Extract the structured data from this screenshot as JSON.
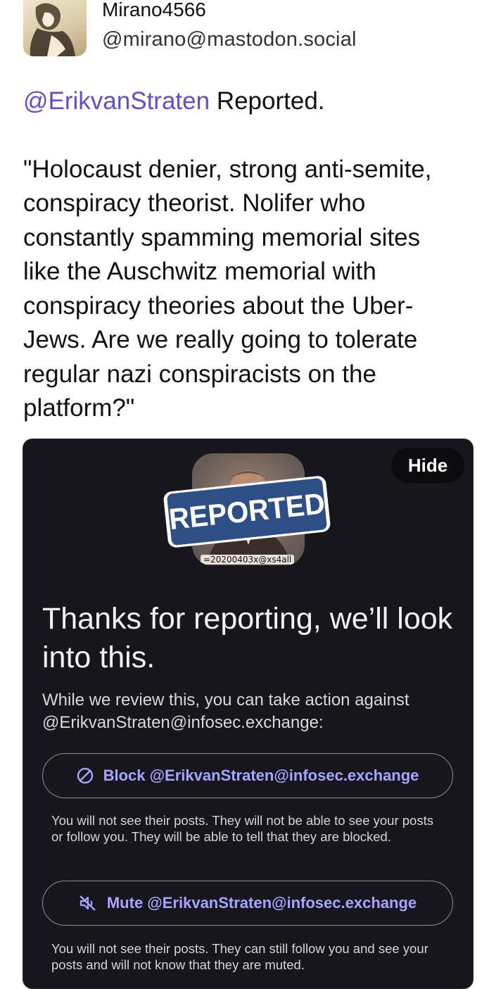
{
  "post": {
    "author": {
      "display_name": "Mirano4566",
      "handle": "@mirano@mastodon.social",
      "avatar_icon": "vintage-illustration-avatar"
    },
    "mention": "@ErikvanStraten",
    "lead_text": " Reported.",
    "quote_lines": [
      "\"Holocaust denier, strong anti-semite,",
      "conspiracy theorist. Nolifer who",
      "constantly spamming memorial sites",
      "like the Auschwitz memorial with",
      "conspiracy theories about the Uber-",
      "Jews. Are we really going to tolerate",
      "regular nazi conspiracists on the",
      "platform?\""
    ],
    "colors": {
      "mention": "#5b4fd6"
    }
  },
  "report_card": {
    "hide_label": "Hide",
    "thumbnail_caption": "=20200403x@xs4all",
    "stamp_text": "REPORTED",
    "title": "Thanks for reporting, we’ll look into this.",
    "description": "While we review this, you can take action against @ErikvanStraten@infosec.exchange:",
    "block_label": "Block @ErikvanStraten@infosec.exchange",
    "block_note": "You will not see their posts. They will not be able to see your posts or follow you. They will be able to tell that they are blocked.",
    "mute_label": "Mute @ErikvanStraten@infosec.exchange",
    "mute_note": "You will not see their posts. They can still follow you and see your posts and will not know that they are muted.",
    "colors": {
      "background": "#17161c",
      "accent": "#a9a4ff",
      "stamp": "#2e4f86"
    }
  }
}
